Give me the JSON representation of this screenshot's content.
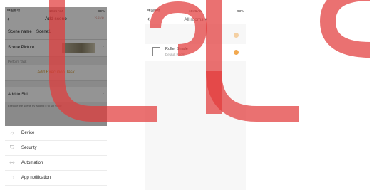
{
  "left_phone": {
    "status": {
      "carrier": "中国移动",
      "time": "10:26 AM",
      "battery": "89%"
    },
    "nav": {
      "back": "‹",
      "title": "Add scene",
      "save": "Save"
    },
    "scene_name": {
      "label": "Scene name",
      "value": "Scene1"
    },
    "scene_picture": {
      "label": "Scene Picture"
    },
    "perform_task_label": "Perform Task",
    "add_task": "Add Execution Task",
    "siri": {
      "label": "Add to Siri",
      "hint": "Execute the scene by adding it to siri voice"
    },
    "menu": [
      {
        "label": "Device",
        "icon": "lightbulb-icon"
      },
      {
        "label": "Security",
        "icon": "shield-icon"
      },
      {
        "label": "Automation",
        "icon": "automation-icon"
      },
      {
        "label": "App notification",
        "icon": "chat-bubble-icon"
      }
    ]
  },
  "right_phone": {
    "status": {
      "carrier": "中国移动",
      "time": "10:26 AM",
      "battery": "93%"
    },
    "nav": {
      "back": "‹",
      "title": "All rooms ▾"
    },
    "device": {
      "name": "Roller Shade",
      "room": "Default Room"
    }
  },
  "colors": {
    "accent": "#f2a950",
    "watermark": "#e23a3a"
  }
}
